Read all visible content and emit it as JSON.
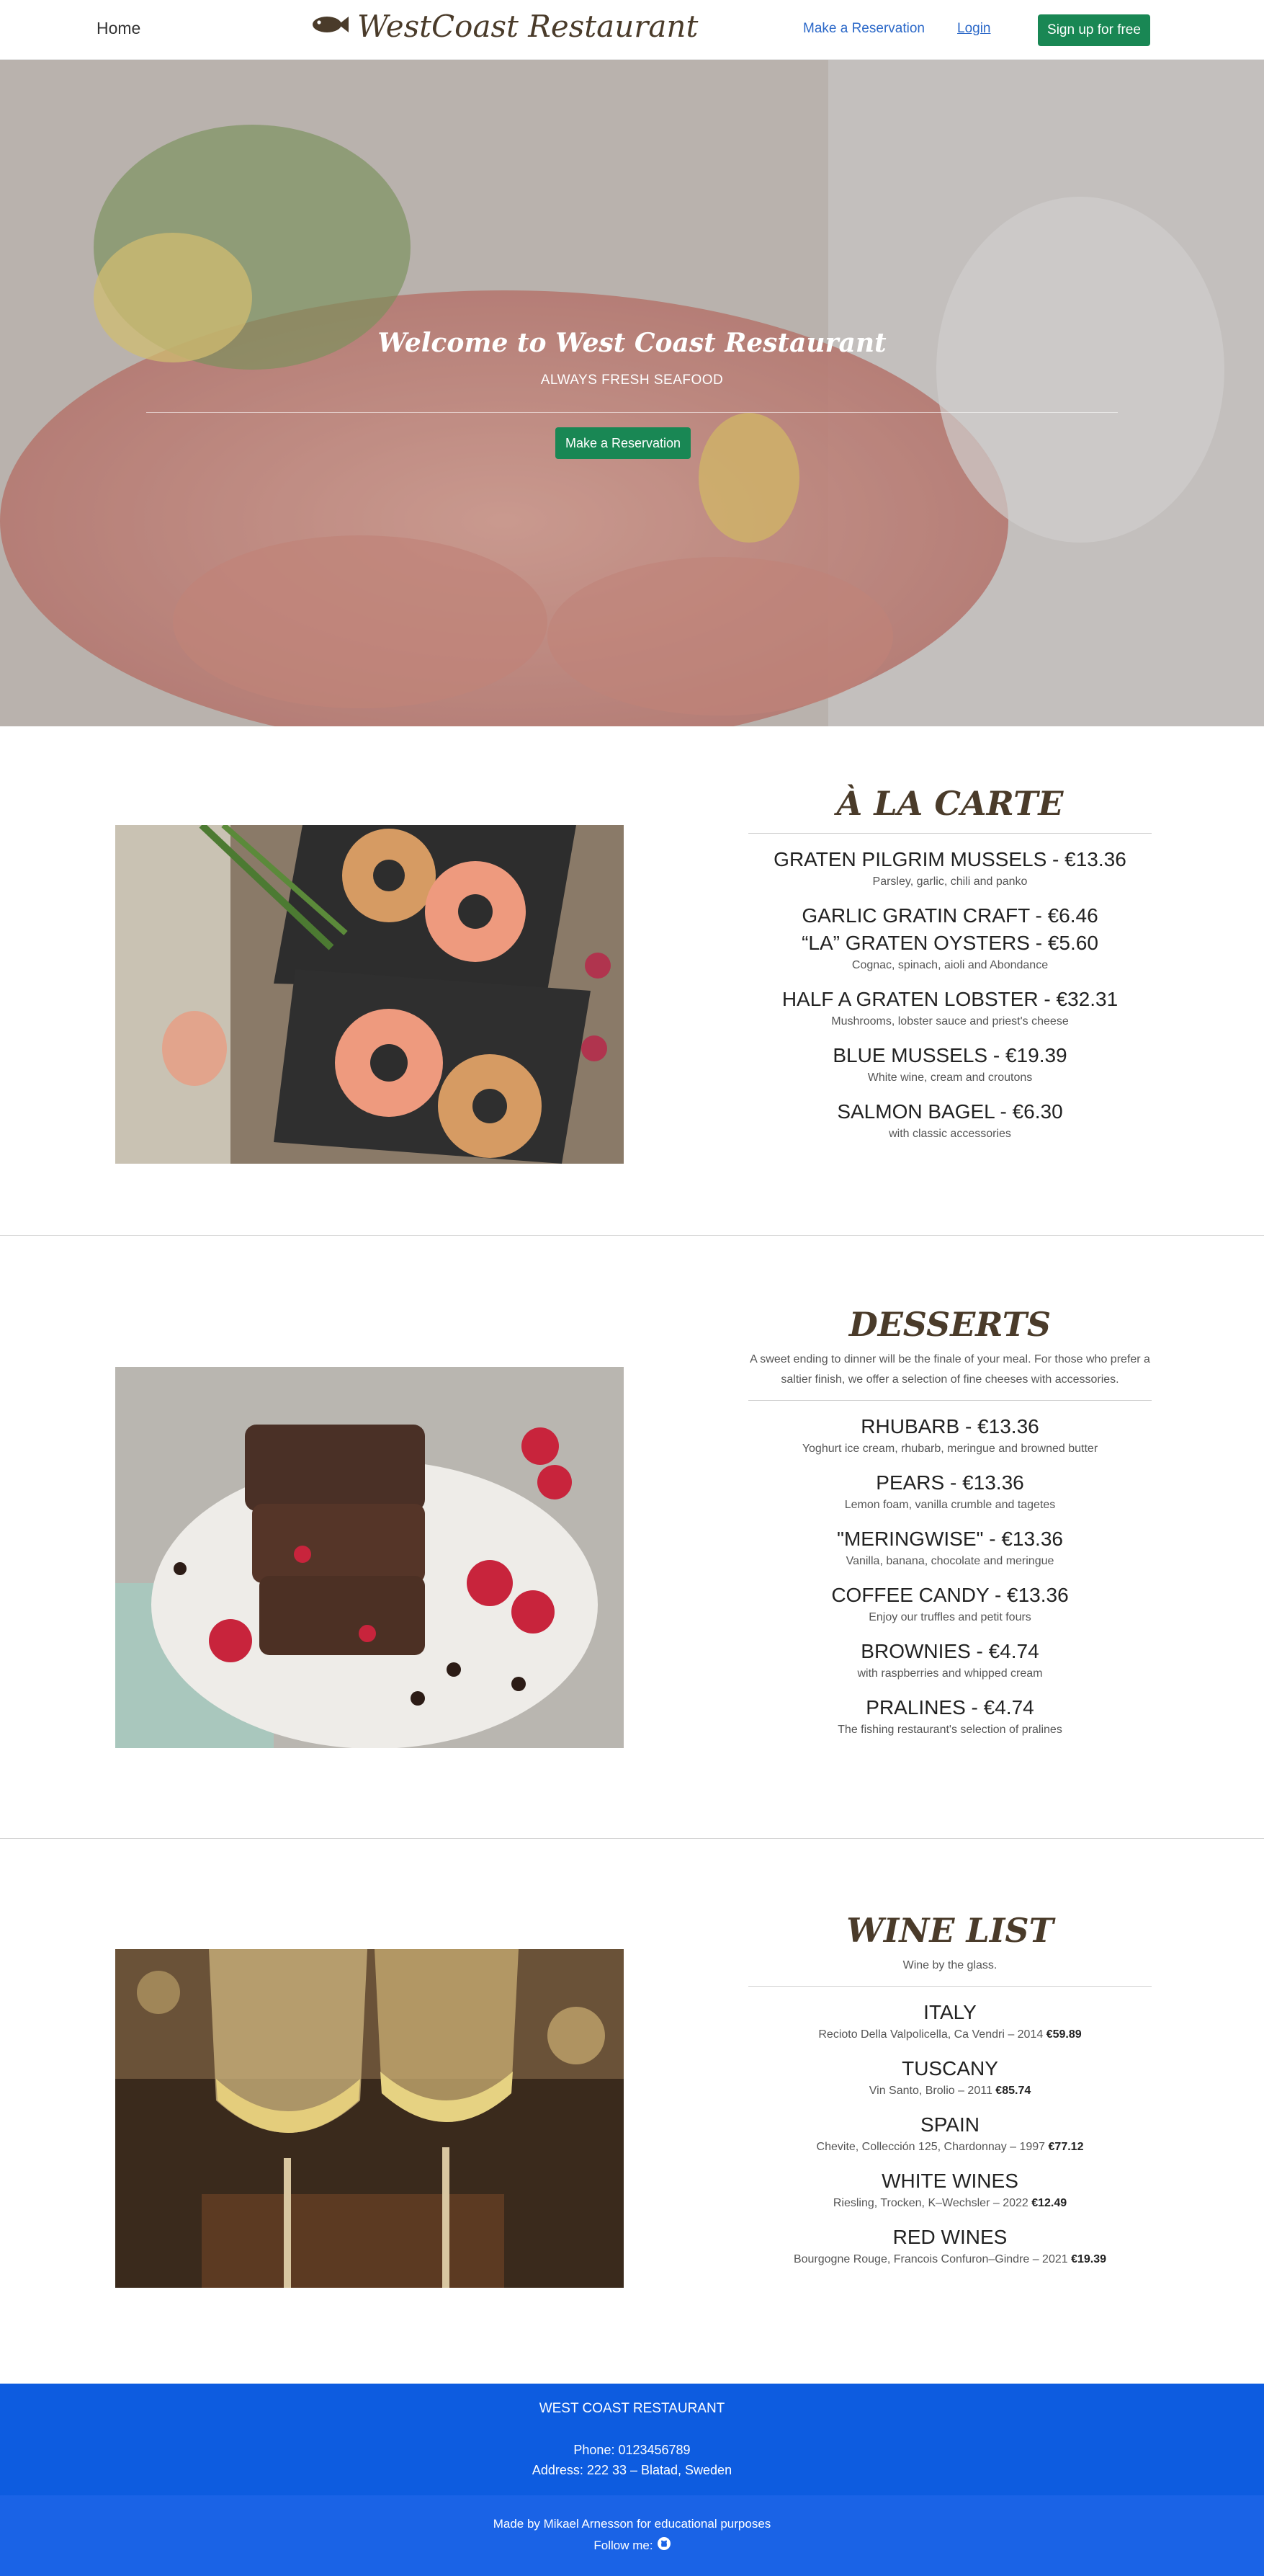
{
  "nav": {
    "home": "Home",
    "brand": "WestCoast Restaurant",
    "reserve": "Make a Reservation",
    "login": "Login",
    "signup": "Sign up for free"
  },
  "hero": {
    "title": "Welcome to West Coast Restaurant",
    "subtitle": "ALWAYS FRESH SEAFOOD",
    "button": "Make a Reservation"
  },
  "carte": {
    "title": "À LA CARTE",
    "items": [
      {
        "name": "GRATEN PILGRIM MUSSELS - €13.36",
        "desc": "Parsley, garlic, chili and panko"
      },
      {
        "name": "GARLIC GRATIN CRAFT - €6.46",
        "name2": "“LA” GRATEN OYSTERS - €5.60",
        "desc": "Cognac, spinach, aioli and Abondance"
      },
      {
        "name": "HALF A GRATEN LOBSTER - €32.31",
        "desc": "Mushrooms, lobster sauce and priest's cheese"
      },
      {
        "name": "BLUE MUSSELS - €19.39",
        "desc": "White wine, cream and croutons"
      },
      {
        "name": "SALMON BAGEL - €6.30",
        "desc": "with classic accessories"
      }
    ]
  },
  "desserts": {
    "title": "DESSERTS",
    "intro": "A sweet ending to dinner will be the finale of your meal. For those who prefer a saltier finish, we offer a selection of fine cheeses with accessories.",
    "items": [
      {
        "name": "RHUBARB - €13.36",
        "desc": "Yoghurt ice cream, rhubarb, meringue and browned butter"
      },
      {
        "name": "PEARS - €13.36",
        "desc": "Lemon foam, vanilla crumble and tagetes"
      },
      {
        "name": "\"MERINGWISE\" - €13.36",
        "desc": "Vanilla, banana, chocolate and meringue"
      },
      {
        "name": "COFFEE CANDY - €13.36",
        "desc": "Enjoy our truffles and petit fours"
      },
      {
        "name": "BROWNIES - €4.74",
        "desc": "with raspberries and whipped cream"
      },
      {
        "name": "PRALINES - €4.74",
        "desc": "The fishing restaurant's selection of pralines"
      }
    ]
  },
  "wine": {
    "title": "WINE LIST",
    "intro": "Wine by the glass.",
    "items": [
      {
        "name": "ITALY",
        "desc": "Recioto Della Valpolicella, Ca Vendri – 2014",
        "price": "€59.89"
      },
      {
        "name": "TUSCANY",
        "desc": "Vin Santo, Brolio – 2011",
        "price": "€85.74"
      },
      {
        "name": "SPAIN",
        "desc": "Chevite, Collección 125, Chardonnay – 1997",
        "price": "€77.12"
      },
      {
        "name": "WHITE WINES",
        "desc": "Riesling, Trocken, K–Wechsler – 2022",
        "price": "€12.49"
      },
      {
        "name": "RED WINES",
        "desc": "Bourgogne Rouge, Francois Confuron–Gindre – 2021",
        "price": "€19.39"
      }
    ]
  },
  "footer": {
    "name": "WEST COAST RESTAURANT",
    "phone": "Phone: 0123456789",
    "address": "Address: 222 33 – Blatad, Sweden",
    "credit": "Made by Mikael Arnesson for educational purposes",
    "follow": "Follow me:"
  },
  "colors": {
    "brand_green": "#198754",
    "footer_blue": "#0d5ce0",
    "brand_brown": "#4a3b2a"
  }
}
